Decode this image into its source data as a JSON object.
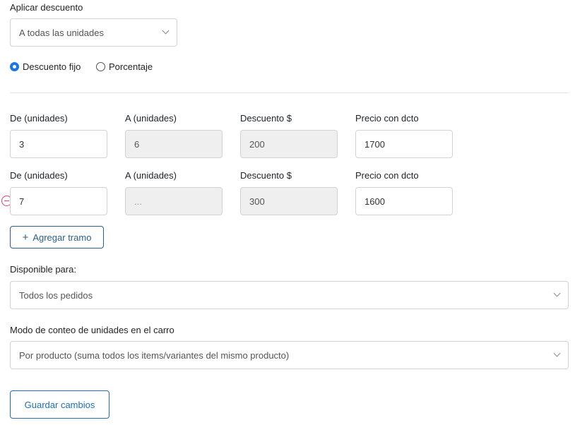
{
  "apply_discount": {
    "label": "Aplicar descuento",
    "selected": "A todas las unidades"
  },
  "discount_type": {
    "options": [
      {
        "label": "Descuento fijo",
        "checked": true
      },
      {
        "label": "Porcentaje",
        "checked": false
      }
    ]
  },
  "tiers": {
    "headers": [
      "De (unidades)",
      "A (unidades)",
      "Descuento $",
      "Precio con dcto"
    ],
    "rows": [
      {
        "from": "3",
        "to": "6",
        "discount": "200",
        "price": "1700"
      },
      {
        "from": "7",
        "to": "...",
        "discount": "300",
        "price": "1600"
      }
    ],
    "add_label": "Agregar tramo"
  },
  "available_for": {
    "label": "Disponible para:",
    "selected": "Todos los pedidos"
  },
  "count_mode": {
    "label": "Modo de conteo de unidades en el carro",
    "selected": "Por producto (suma todos los items/variantes del mismo producto)"
  },
  "save_label": "Guardar cambios"
}
